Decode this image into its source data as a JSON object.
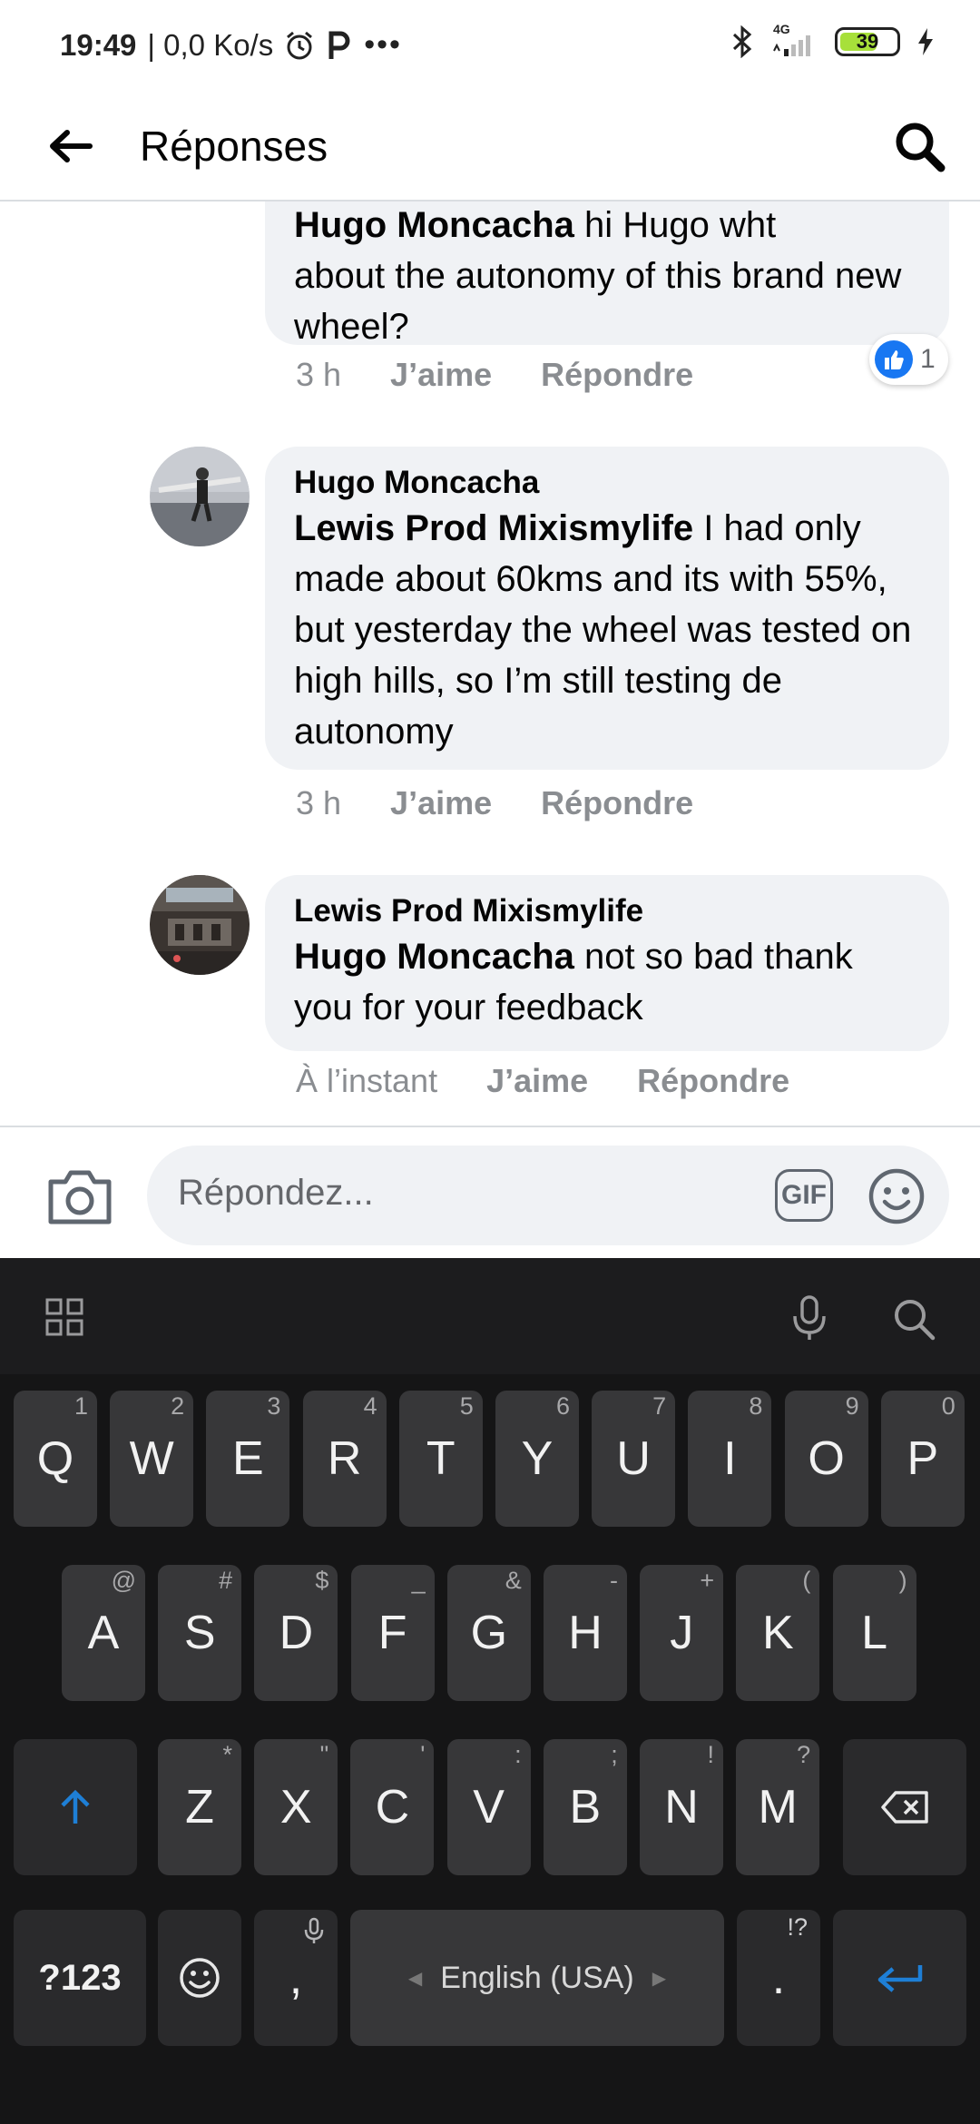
{
  "status_bar": {
    "time": "19:49",
    "speed": "| 0,0 Ko/s",
    "network": "4G",
    "battery": "39"
  },
  "header": {
    "title": "Réponses"
  },
  "comments": [
    {
      "author": "Hugo Moncacha",
      "mention": "",
      "text_line1_rest": "hi Hugo wht",
      "text": "about the autonomy of this brand new wheel?",
      "time": "3 h",
      "like": "J’aime",
      "reply": "Répondre",
      "reaction_count": "1"
    },
    {
      "author": "Hugo Moncacha",
      "mention": "Lewis Prod Mixismylife",
      "text": " I had only made about 60kms and its with 55%, but yesterday the wheel was tested on high hills, so I’m still testing de autonomy",
      "time": "3 h",
      "like": "J’aime",
      "reply": "Répondre"
    },
    {
      "author": "Lewis Prod Mixismylife",
      "mention": "Hugo Moncacha",
      "text": " not so bad thank you for your feedback",
      "time": "À l’instant",
      "like": "J’aime",
      "reply": "Répondre"
    }
  ],
  "composer": {
    "placeholder": "Répondez...",
    "gif_label": "GIF"
  },
  "keyboard": {
    "row1": [
      {
        "k": "Q",
        "h": "1"
      },
      {
        "k": "W",
        "h": "2"
      },
      {
        "k": "E",
        "h": "3"
      },
      {
        "k": "R",
        "h": "4"
      },
      {
        "k": "T",
        "h": "5"
      },
      {
        "k": "Y",
        "h": "6"
      },
      {
        "k": "U",
        "h": "7"
      },
      {
        "k": "I",
        "h": "8"
      },
      {
        "k": "O",
        "h": "9"
      },
      {
        "k": "P",
        "h": "0"
      }
    ],
    "row2": [
      {
        "k": "A",
        "h": "@"
      },
      {
        "k": "S",
        "h": "#"
      },
      {
        "k": "D",
        "h": "$"
      },
      {
        "k": "F",
        "h": "_"
      },
      {
        "k": "G",
        "h": "&"
      },
      {
        "k": "H",
        "h": "-"
      },
      {
        "k": "J",
        "h": "+"
      },
      {
        "k": "K",
        "h": "("
      },
      {
        "k": "L",
        "h": ")"
      }
    ],
    "row3": [
      {
        "k": "Z",
        "h": "*"
      },
      {
        "k": "X",
        "h": "\""
      },
      {
        "k": "C",
        "h": "'"
      },
      {
        "k": "V",
        "h": ":"
      },
      {
        "k": "B",
        "h": ";"
      },
      {
        "k": "N",
        "h": "!"
      },
      {
        "k": "M",
        "h": "?"
      }
    ],
    "symbols_label": "?123",
    "comma": ",",
    "period": ".",
    "period_hint": "!?",
    "space_label": "English (USA)"
  },
  "icons": {
    "back": "arrow-left-icon",
    "search": "search-icon",
    "camera": "camera-icon",
    "emoji": "emoji-icon",
    "like": "thumbs-up-icon",
    "mic": "mic-icon",
    "grid": "grid-icon",
    "shift": "shift-icon",
    "backspace": "backspace-icon",
    "enter": "enter-icon"
  },
  "colors": {
    "accent": "#1877f2",
    "bubble": "#f0f2f5",
    "keyboard_bg": "#151516",
    "key_bg": "#373739",
    "battery": "#a7e03a"
  }
}
